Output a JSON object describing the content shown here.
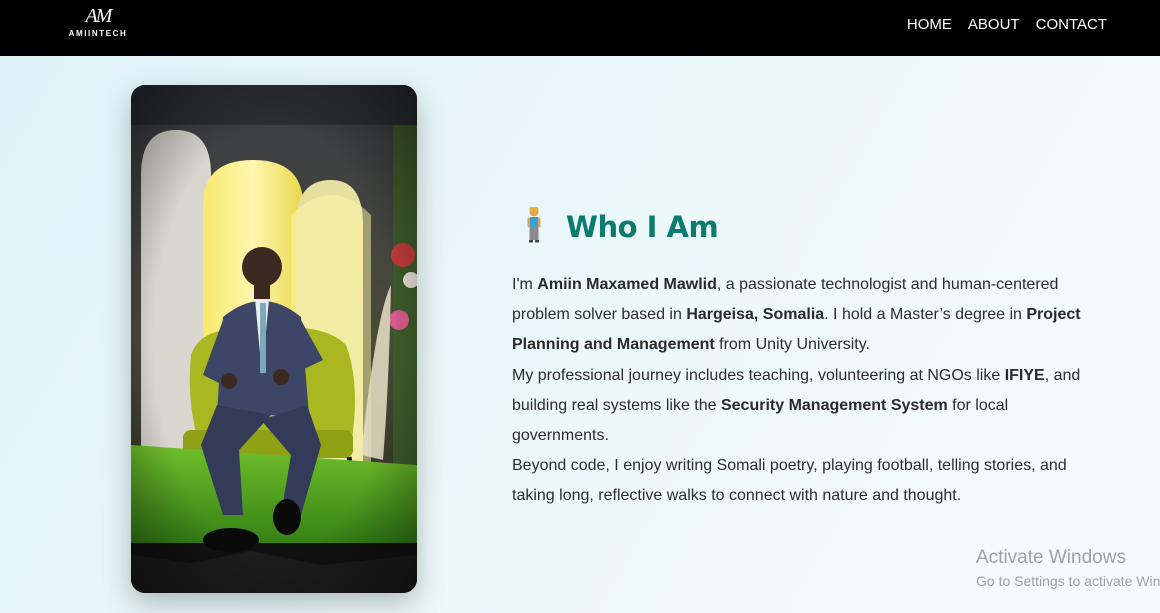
{
  "navbar": {
    "logo_mark": "AM",
    "logo_text": "AMIINTECH",
    "links": [
      "HOME",
      "ABOUT",
      "CONTACT"
    ]
  },
  "about": {
    "icon": "person-standing-icon",
    "title": "Who I Am",
    "bio": [
      {
        "t": "I'm "
      },
      {
        "t": "Amiin Maxamed Mawlid",
        "b": true
      },
      {
        "t": ", a passionate technologist and human-centered problem solver based in "
      },
      {
        "t": "Hargeisa, Somalia",
        "b": true
      },
      {
        "t": ". I hold a Master’s degree in "
      },
      {
        "t": "Project Planning and Management",
        "b": true
      },
      {
        "t": " from Unity University."
      },
      {
        "br": true
      },
      {
        "t": "My professional journey includes teaching, volunteering at NGOs like "
      },
      {
        "t": "IFIYE",
        "b": true
      },
      {
        "t": ", and building real systems like the "
      },
      {
        "t": "Security Management System",
        "b": true
      },
      {
        "t": " for local governments."
      },
      {
        "br": true
      },
      {
        "t": "Beyond code, I enjoy writing Somali poetry, playing football, telling stories, and taking long, reflective walks to connect with nature and thought."
      }
    ]
  },
  "watermark": {
    "title": "Activate Windows",
    "subtitle": "Go to Settings to activate Windows."
  }
}
